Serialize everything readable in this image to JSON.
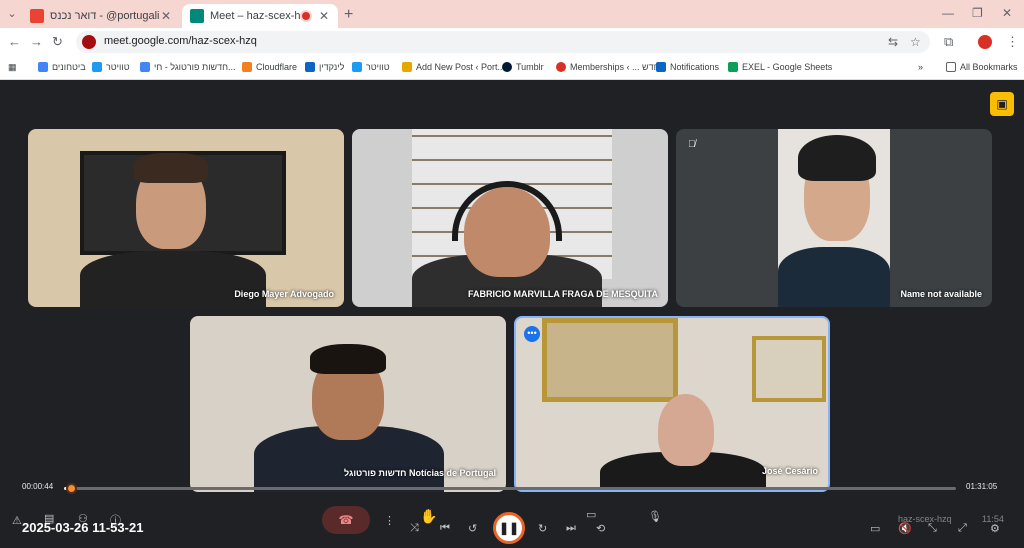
{
  "browser": {
    "tabs": [
      {
        "title": "דואר נכנס - @portugalisrael.com",
        "active": false
      },
      {
        "title": "Meet – haz-scex-hzq",
        "active": true
      }
    ],
    "new_tab": "+",
    "address": "meet.google.com/haz-scex-hzq",
    "bookmarks": [
      {
        "label": "ביטחונים",
        "color": "#4285f4"
      },
      {
        "label": "טוויטר",
        "color": "#1d9bf0"
      },
      {
        "label": "חדשות פורטוגל - חי...",
        "color": "#4285f4"
      },
      {
        "label": "Cloudflare",
        "color": "#f38020"
      },
      {
        "label": "לינקדין",
        "color": "#0a66c2"
      },
      {
        "label": "טוויטר",
        "color": "#1d9bf0"
      },
      {
        "label": "Add New Post ‹ Port...",
        "color": "#e6a800"
      },
      {
        "label": "Tumblr",
        "color": "#001935"
      },
      {
        "label": "Memberships ‹ ... חדש",
        "color": "#d93025"
      },
      {
        "label": "Notifications",
        "color": "#0a66c2"
      },
      {
        "label": "EXEL - Google Sheets",
        "color": "#0f9d58"
      }
    ],
    "all_bookmarks": "All Bookmarks"
  },
  "meet": {
    "participants": [
      {
        "name": "Diego Mayer Advogado"
      },
      {
        "name": "FABRICIO MARVILLA FRAGA DE MESQUITA"
      },
      {
        "name": "Name not available",
        "muted": true
      },
      {
        "name": "חדשות פורטוגל Notícias de Portugal"
      },
      {
        "name": "José Cesário",
        "speaking": true
      }
    ],
    "meeting_code": "haz-scex-hzq",
    "clock": "11:54"
  },
  "player": {
    "elapsed": "00:00:44",
    "total": "01:31:05",
    "progress": 0.008,
    "timestamp": "2025-03-26 11-53-21"
  },
  "colors": {
    "accent": "#ff8a30",
    "speaking_border": "#8ab4f8"
  }
}
